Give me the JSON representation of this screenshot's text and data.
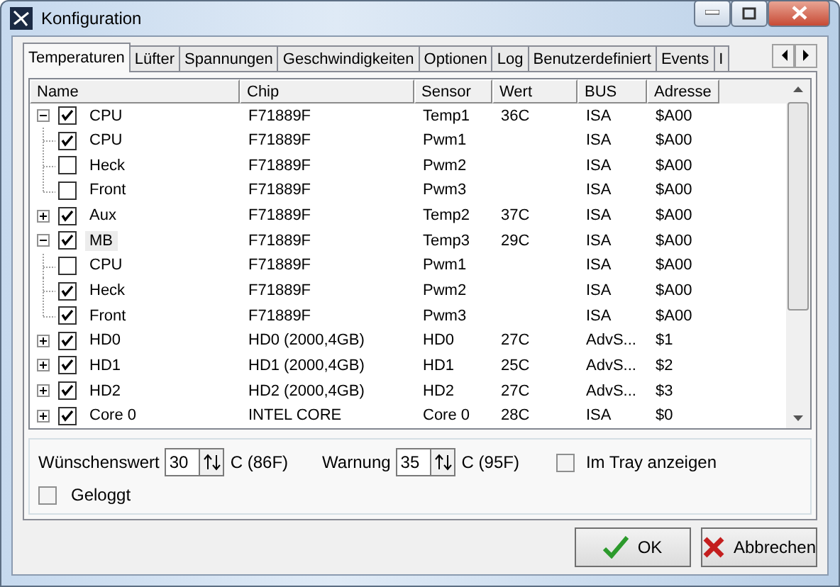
{
  "window": {
    "title": "Konfiguration"
  },
  "tabs": [
    {
      "label": "Temperaturen",
      "selected": true
    },
    {
      "label": "Lüfter",
      "selected": false
    },
    {
      "label": "Spannungen",
      "selected": false
    },
    {
      "label": "Geschwindigkeiten",
      "selected": false
    },
    {
      "label": "Optionen",
      "selected": false
    },
    {
      "label": "Log",
      "selected": false
    },
    {
      "label": "Benutzerdefiniert",
      "selected": false
    },
    {
      "label": "Events",
      "selected": false
    },
    {
      "label": "I",
      "selected": false
    }
  ],
  "columns": [
    "Name",
    "Chip",
    "Sensor",
    "Wert",
    "BUS",
    "Adresse"
  ],
  "rows": [
    {
      "name": "CPU",
      "chip": "F71889F",
      "sensor": "Temp1",
      "value": "36C",
      "bus": "ISA",
      "address": "$A00",
      "checked": true,
      "expanded": true,
      "selected": false,
      "children": [
        {
          "name": "CPU",
          "chip": "F71889F",
          "sensor": "Pwm1",
          "bus": "ISA",
          "address": "$A00",
          "checked": true,
          "selected": false
        },
        {
          "name": "Heck",
          "chip": "F71889F",
          "sensor": "Pwm2",
          "bus": "ISA",
          "address": "$A00",
          "checked": false,
          "selected": false
        },
        {
          "name": "Front",
          "chip": "F71889F",
          "sensor": "Pwm3",
          "bus": "ISA",
          "address": "$A00",
          "checked": false,
          "selected": false
        }
      ]
    },
    {
      "name": "Aux",
      "chip": "F71889F",
      "sensor": "Temp2",
      "value": "37C",
      "bus": "ISA",
      "address": "$A00",
      "checked": true,
      "expanded": false,
      "selected": false
    },
    {
      "name": "MB",
      "chip": "F71889F",
      "sensor": "Temp3",
      "value": "29C",
      "bus": "ISA",
      "address": "$A00",
      "checked": true,
      "expanded": true,
      "selected": true,
      "children": [
        {
          "name": "CPU",
          "chip": "F71889F",
          "sensor": "Pwm1",
          "bus": "ISA",
          "address": "$A00",
          "checked": false,
          "selected": false
        },
        {
          "name": "Heck",
          "chip": "F71889F",
          "sensor": "Pwm2",
          "bus": "ISA",
          "address": "$A00",
          "checked": true,
          "selected": false
        },
        {
          "name": "Front",
          "chip": "F71889F",
          "sensor": "Pwm3",
          "bus": "ISA",
          "address": "$A00",
          "checked": true,
          "selected": false
        }
      ]
    },
    {
      "name": "HD0",
      "chip": "HD0 (2000,4GB)",
      "sensor": "HD0",
      "value": "27C",
      "bus": "AdvS...",
      "address": "$1",
      "checked": true,
      "expanded": false,
      "selected": false
    },
    {
      "name": "HD1",
      "chip": "HD1 (2000,4GB)",
      "sensor": "HD1",
      "value": "25C",
      "bus": "AdvS...",
      "address": "$2",
      "checked": true,
      "expanded": false,
      "selected": false
    },
    {
      "name": "HD2",
      "chip": "HD2 (2000,4GB)",
      "sensor": "HD2",
      "value": "27C",
      "bus": "AdvS...",
      "address": "$3",
      "checked": true,
      "expanded": false,
      "selected": false
    },
    {
      "name": "Core 0",
      "chip": "INTEL CORE",
      "sensor": "Core 0",
      "value": "28C",
      "bus": "ISA",
      "address": "$0",
      "checked": true,
      "expanded": false,
      "selected": false
    }
  ],
  "settings": {
    "target_label": "Wünschenswert",
    "target_value": "30",
    "target_unit": "C (86F)",
    "warning_label": "Warnung",
    "warning_value": "35",
    "warning_unit": "C (95F)",
    "tray": {
      "label": "Im Tray anzeigen",
      "checked": false
    },
    "logged": {
      "label": "Geloggt",
      "checked": false
    }
  },
  "buttons": {
    "ok": "OK",
    "cancel": "Abbrechen"
  }
}
